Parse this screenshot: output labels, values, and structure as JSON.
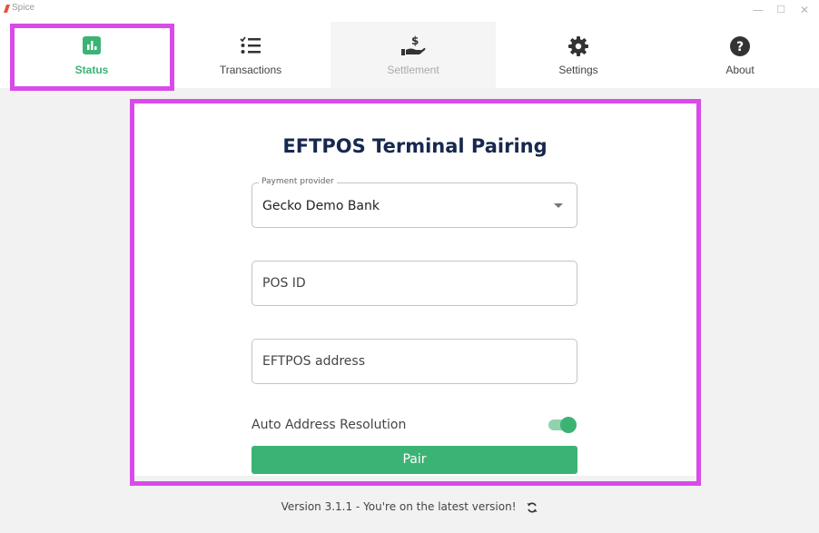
{
  "window": {
    "title": "Spice",
    "controls": [
      "—",
      "☐",
      "✕"
    ]
  },
  "tabs": [
    {
      "id": "status",
      "label": "Status",
      "icon": "bar-chart-icon",
      "active": true
    },
    {
      "id": "transactions",
      "label": "Transactions",
      "icon": "list-check-icon"
    },
    {
      "id": "settlement",
      "label": "Settlement",
      "icon": "hand-dollar-icon",
      "disabled": true
    },
    {
      "id": "settings",
      "label": "Settings",
      "icon": "gear-icon"
    },
    {
      "id": "about",
      "label": "About",
      "icon": "question-circle-icon"
    }
  ],
  "pairing": {
    "heading": "EFTPOS Terminal Pairing",
    "provider_label": "Payment provider",
    "provider_value": "Gecko Demo Bank",
    "pos_id_placeholder": "POS ID",
    "eftpos_address_placeholder": "EFTPOS address",
    "auto_address_label": "Auto Address Resolution",
    "auto_address_enabled": true,
    "pair_label": "Pair"
  },
  "footer": {
    "version_text": "Version 3.1.1 - You're on the latest version!",
    "refresh_icon": "refresh-icon"
  },
  "colors": {
    "accent_green": "#3bb375",
    "heading_navy": "#17284f",
    "highlight_magenta": "#d94be8"
  }
}
